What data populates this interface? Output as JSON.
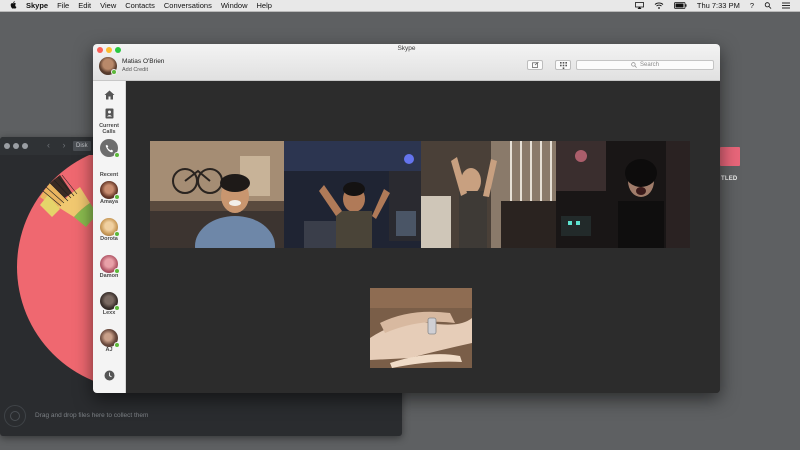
{
  "menubar": {
    "app_name": "Skype",
    "items": [
      "File",
      "Edit",
      "View",
      "Contacts",
      "Conversations",
      "Window",
      "Help"
    ],
    "clock": "Thu 7:33 PM"
  },
  "desktop": {
    "untitled_label": "TLED"
  },
  "disk_window": {
    "tab_label": "Disk",
    "footer_text": "Drag and drop files here to collect them"
  },
  "skype": {
    "title": "Skype",
    "user": {
      "name": "Matias O'Brien",
      "sub": "Add Credit"
    },
    "search_placeholder": "Search",
    "sidebar": {
      "current_calls_line1": "Current",
      "current_calls_line2": "Calls",
      "recent_label": "Recent",
      "contacts": [
        {
          "name": "Amaya",
          "online": true
        },
        {
          "name": "Dorota",
          "online": true
        },
        {
          "name": "Damon",
          "online": true
        },
        {
          "name": "Lexx",
          "online": true
        },
        {
          "name": "AJ",
          "online": true
        }
      ]
    },
    "participants": [
      "video-participant-1",
      "video-participant-2",
      "video-participant-3",
      "video-participant-4",
      "self-view"
    ]
  },
  "colors": {
    "skype_stage": "#2c2c2c",
    "online_green": "#5cb83a",
    "disk_pink": "#ef6870",
    "desktop_bg": "#5e6062"
  }
}
